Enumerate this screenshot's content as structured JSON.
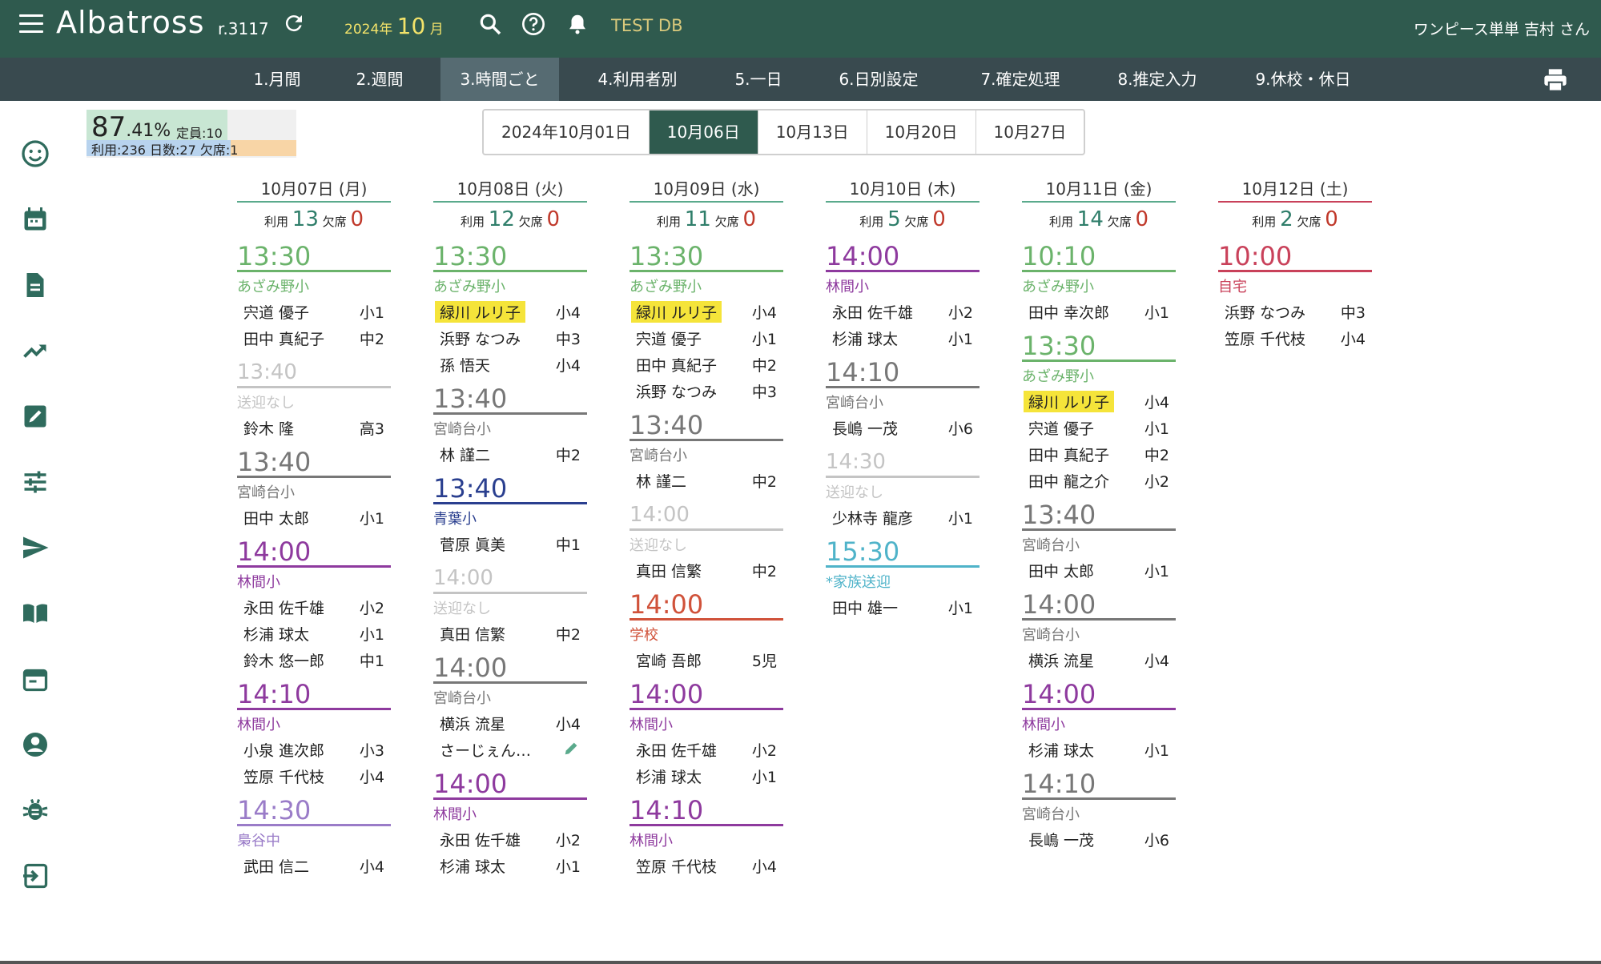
{
  "app": {
    "logo": "Albatross",
    "revision": "r.3117",
    "year": "2024年",
    "month_num": "10",
    "month_suffix": "月",
    "db_label": "TEST DB",
    "user": "ワンピース単単 吉村 さん"
  },
  "nav_tabs": [
    "1.月間",
    "2.週間",
    "3.時間ごと",
    "4.利用者別",
    "5.一日",
    "6.日別設定",
    "7.確定処理",
    "8.推定入力",
    "9.休校・休日"
  ],
  "active_tab": "3.時間ごと",
  "stats": {
    "pct_main": "87",
    "pct_dec": ".41%",
    "capacity": "定員:10",
    "line2": "利用:236 日数:27 欠席:1"
  },
  "weeks": [
    "2024年10月01日",
    "10月06日",
    "10月13日",
    "10月20日",
    "10月27日"
  ],
  "active_week": "10月06日",
  "counts_labels": {
    "use": "利用",
    "absent": "欠席"
  },
  "days": [
    {
      "title": "10月07日 (月)",
      "use": "13",
      "absent": "0",
      "color": "#5aaa8c",
      "slots": [
        {
          "time": "13:30",
          "dest": "あざみ野小",
          "color": "#6bb36b",
          "people": [
            {
              "n": "宍道 優子",
              "g": "小1"
            },
            {
              "n": "田中 真紀子",
              "g": "中2"
            }
          ]
        },
        {
          "time": "13:40",
          "dest": "送迎なし",
          "color": "#c4c4c4",
          "small": true,
          "people": [
            {
              "n": "鈴木 隆",
              "g": "高3"
            }
          ]
        },
        {
          "time": "13:40",
          "dest": "宮崎台小",
          "color": "#777777",
          "people": [
            {
              "n": "田中 太郎",
              "g": "小1"
            }
          ]
        },
        {
          "time": "14:00",
          "dest": "林間小",
          "color": "#8e3a9e",
          "people": [
            {
              "n": "永田 佐千雄",
              "g": "小2"
            },
            {
              "n": "杉浦 球太",
              "g": "小1"
            },
            {
              "n": "鈴木 悠一郎",
              "g": "中1"
            }
          ]
        },
        {
          "time": "14:10",
          "dest": "林間小",
          "color": "#8e3a9e",
          "people": [
            {
              "n": "小泉 進次郎",
              "g": "小3"
            },
            {
              "n": "笠原 千代枝",
              "g": "小4"
            }
          ]
        },
        {
          "time": "14:30",
          "dest": "梟谷中",
          "color": "#9a7cc8",
          "people": [
            {
              "n": "武田 信二",
              "g": "小4"
            }
          ]
        }
      ]
    },
    {
      "title": "10月08日 (火)",
      "use": "12",
      "absent": "0",
      "color": "#5aaa8c",
      "slots": [
        {
          "time": "13:30",
          "dest": "あざみ野小",
          "color": "#6bb36b",
          "people": [
            {
              "n": "緑川 ルリ子",
              "g": "小4",
              "hl": true
            },
            {
              "n": "浜野 なつみ",
              "g": "中3"
            },
            {
              "n": "孫 悟天",
              "g": "小4"
            }
          ]
        },
        {
          "time": "13:40",
          "dest": "宮崎台小",
          "color": "#777777",
          "people": [
            {
              "n": "林 謹二",
              "g": "中2"
            }
          ]
        },
        {
          "time": "13:40",
          "dest": "青葉小",
          "color": "#2a3f8f",
          "people": [
            {
              "n": "菅原 眞美",
              "g": "中1"
            }
          ]
        },
        {
          "time": "14:00",
          "dest": "送迎なし",
          "color": "#c4c4c4",
          "small": true,
          "people": [
            {
              "n": "真田 信繁",
              "g": "中2"
            }
          ]
        },
        {
          "time": "14:00",
          "dest": "宮崎台小",
          "color": "#777777",
          "people": [
            {
              "n": "横浜 流星",
              "g": "小4"
            },
            {
              "n": "さーじぇん…",
              "g": "",
              "pen": true
            }
          ]
        },
        {
          "time": "14:00",
          "dest": "林間小",
          "color": "#8e3a9e",
          "people": [
            {
              "n": "永田 佐千雄",
              "g": "小2"
            },
            {
              "n": "杉浦 球太",
              "g": "小1"
            }
          ]
        }
      ]
    },
    {
      "title": "10月09日 (水)",
      "use": "11",
      "absent": "0",
      "color": "#5aaa8c",
      "slots": [
        {
          "time": "13:30",
          "dest": "あざみ野小",
          "color": "#6bb36b",
          "people": [
            {
              "n": "緑川 ルリ子",
              "g": "小4",
              "hl": true
            },
            {
              "n": "宍道 優子",
              "g": "小1"
            },
            {
              "n": "田中 真紀子",
              "g": "中2"
            },
            {
              "n": "浜野 なつみ",
              "g": "中3"
            }
          ]
        },
        {
          "time": "13:40",
          "dest": "宮崎台小",
          "color": "#777777",
          "people": [
            {
              "n": "林 謹二",
              "g": "中2"
            }
          ]
        },
        {
          "time": "14:00",
          "dest": "送迎なし",
          "color": "#c4c4c4",
          "small": true,
          "people": [
            {
              "n": "真田 信繁",
              "g": "中2"
            }
          ]
        },
        {
          "time": "14:00",
          "dest": "学校",
          "color": "#d0523a",
          "people": [
            {
              "n": "宮崎 吾郎",
              "g": "5児"
            }
          ]
        },
        {
          "time": "14:00",
          "dest": "林間小",
          "color": "#8e3a9e",
          "people": [
            {
              "n": "永田 佐千雄",
              "g": "小2"
            },
            {
              "n": "杉浦 球太",
              "g": "小1"
            }
          ]
        },
        {
          "time": "14:10",
          "dest": "林間小",
          "color": "#8e3a9e",
          "people": [
            {
              "n": "笠原 千代枝",
              "g": "小4"
            }
          ]
        }
      ]
    },
    {
      "title": "10月10日 (木)",
      "use": "5",
      "absent": "0",
      "color": "#5aaa8c",
      "slots": [
        {
          "time": "14:00",
          "dest": "林間小",
          "color": "#8e3a9e",
          "people": [
            {
              "n": "永田 佐千雄",
              "g": "小2"
            },
            {
              "n": "杉浦 球太",
              "g": "小1"
            }
          ]
        },
        {
          "time": "14:10",
          "dest": "宮崎台小",
          "color": "#777777",
          "people": [
            {
              "n": "長嶋 一茂",
              "g": "小6"
            }
          ]
        },
        {
          "time": "14:30",
          "dest": "送迎なし",
          "color": "#c4c4c4",
          "small": true,
          "people": [
            {
              "n": "少林寺 龍彦",
              "g": "小1"
            }
          ]
        },
        {
          "time": "15:30",
          "dest": "*家族送迎",
          "color": "#4fb3c9",
          "people": [
            {
              "n": "田中 雄一",
              "g": "小1"
            }
          ]
        }
      ]
    },
    {
      "title": "10月11日 (金)",
      "use": "14",
      "absent": "0",
      "color": "#5aaa8c",
      "slots": [
        {
          "time": "10:10",
          "dest": "あざみ野小",
          "color": "#6bb36b",
          "people": [
            {
              "n": "田中 幸次郎",
              "g": "小1"
            }
          ]
        },
        {
          "time": "13:30",
          "dest": "あざみ野小",
          "color": "#6bb36b",
          "people": [
            {
              "n": "緑川 ルリ子",
              "g": "小4",
              "hl": true
            },
            {
              "n": "宍道 優子",
              "g": "小1"
            },
            {
              "n": "田中 真紀子",
              "g": "中2"
            },
            {
              "n": "田中 龍之介",
              "g": "小2"
            }
          ]
        },
        {
          "time": "13:40",
          "dest": "宮崎台小",
          "color": "#777777",
          "people": [
            {
              "n": "田中 太郎",
              "g": "小1"
            }
          ]
        },
        {
          "time": "14:00",
          "dest": "宮崎台小",
          "color": "#777777",
          "people": [
            {
              "n": "横浜 流星",
              "g": "小4"
            }
          ]
        },
        {
          "time": "14:00",
          "dest": "林間小",
          "color": "#8e3a9e",
          "people": [
            {
              "n": "杉浦 球太",
              "g": "小1"
            }
          ]
        },
        {
          "time": "14:10",
          "dest": "宮崎台小",
          "color": "#777777",
          "people": [
            {
              "n": "長嶋 一茂",
              "g": "小6"
            }
          ]
        }
      ]
    },
    {
      "title": "10月12日 (土)",
      "use": "2",
      "absent": "0",
      "color": "#c9415a",
      "slots": [
        {
          "time": "10:00",
          "dest": "自宅",
          "color": "#c9415a",
          "people": [
            {
              "n": "浜野 なつみ",
              "g": "中3"
            },
            {
              "n": "笠原 千代枝",
              "g": "小4"
            }
          ]
        }
      ]
    }
  ]
}
